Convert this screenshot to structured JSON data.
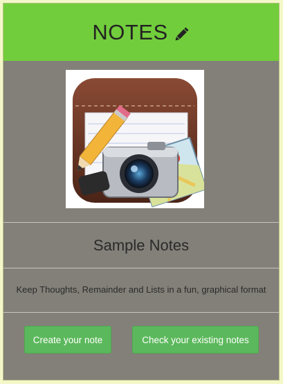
{
  "header": {
    "title": "NOTES",
    "icon": "pencil-icon",
    "background_color": "#72cd3c"
  },
  "app": {
    "logo": "notes-app-logo",
    "title": "Sample Notes",
    "tagline": "Keep Thoughts, Remainder and Lists in a fun, graphical format"
  },
  "actions": {
    "create_label": "Create your note",
    "check_label": "Check your existing notes",
    "button_color": "#5cb85c"
  },
  "page": {
    "background_color": "#838079"
  }
}
